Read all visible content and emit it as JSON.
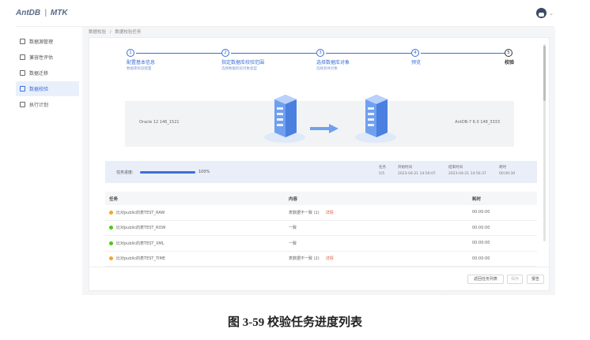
{
  "header": {
    "logo_left": "AntDB",
    "logo_right": "MTK"
  },
  "sidebar": {
    "items": [
      {
        "label": "数据源管理",
        "icon": "database-icon",
        "active": false
      },
      {
        "label": "兼容性评估",
        "icon": "assessment-icon",
        "active": false
      },
      {
        "label": "数据迁移",
        "icon": "folder-icon",
        "active": false
      },
      {
        "label": "数据校验",
        "icon": "verify-icon",
        "active": true
      },
      {
        "label": "执行计划",
        "icon": "calendar-icon",
        "active": false
      }
    ]
  },
  "breadcrumb": {
    "parent": "数据校验",
    "separator": "/",
    "current": "数据校验任务"
  },
  "steps": [
    {
      "num": "1",
      "label": "配置基本信息",
      "sub": "数据库校验配置"
    },
    {
      "num": "2",
      "label": "指定数据库校验范围",
      "sub": "选择数据校验对象类型"
    },
    {
      "num": "3",
      "label": "选择数据库对象",
      "sub": "选择具体对象"
    },
    {
      "num": "4",
      "label": "预览",
      "sub": ""
    },
    {
      "num": "5",
      "label": "校验",
      "sub": ""
    }
  ],
  "banner": {
    "source": "Oracle 12 146_1521",
    "target": "AntDB-7 6.0 148_3333"
  },
  "progress": {
    "label": "任务进度:",
    "percent_text": "100%",
    "fraction": 1.0,
    "stats": [
      {
        "label": "任务",
        "value": "5/5"
      },
      {
        "label": "开始时间",
        "value": "2023-04-21 14:56:07"
      },
      {
        "label": "结束时间",
        "value": "2023-04-21 14:56:37"
      },
      {
        "label": "耗时",
        "value": "00:00:30"
      }
    ]
  },
  "table": {
    "columns": [
      "任务",
      "内容",
      "耗时"
    ],
    "rows": [
      {
        "task": "比对public的表TEST_RAW",
        "content": "表数据不一致 (1)",
        "detail": "详情",
        "duration": "00:00:00",
        "status_color": "#f5a623"
      },
      {
        "task": "比对public的表TEST_ROW",
        "content": "一致",
        "detail": "",
        "duration": "00:00:00",
        "status_color": "#52c41a"
      },
      {
        "task": "比对public的表TEST_XML",
        "content": "一致",
        "detail": "",
        "duration": "00:00:00",
        "status_color": "#52c41a"
      },
      {
        "task": "比对public的表TEST_TIME",
        "content": "表数据不一致 (2)",
        "detail": "详情",
        "duration": "00:00:00",
        "status_color": "#f5a623"
      }
    ]
  },
  "footer": {
    "back_label": "返回任务列表",
    "prev_label": "保存",
    "report_label": "报告"
  },
  "caption": "图 3-59  校验任务进度列表",
  "colors": {
    "accent": "#3a6fd8",
    "warning": "#f5a623",
    "success": "#52c41a",
    "detail_link": "#e25c3b"
  }
}
